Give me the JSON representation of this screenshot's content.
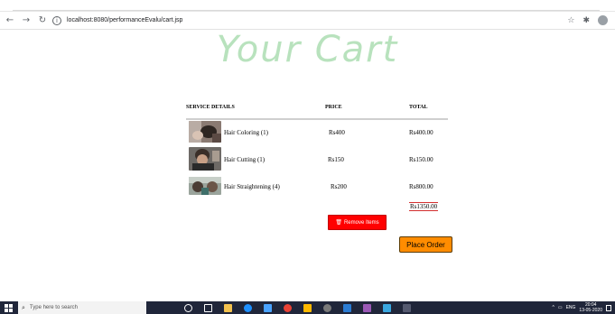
{
  "browser": {
    "url": "localhost:8080/performanceEvalu/cart.jsp",
    "back_icon": "back-arrow-icon",
    "forward_icon": "forward-arrow-icon",
    "reload_icon": "reload-icon",
    "info_icon": "info-icon",
    "star_icon": "star-icon",
    "extensions_icon": "puzzle-icon",
    "profile_icon": "profile-avatar-icon"
  },
  "page": {
    "title": "Your Cart"
  },
  "cart": {
    "headers": {
      "details": "SERVICE DETAILS",
      "price": "PRICE",
      "total": "TOTAL"
    },
    "items": [
      {
        "name": "Hair Coloring (1)",
        "price": "Rs400",
        "total": "Rs400.00"
      },
      {
        "name": "Hair Cutting (1)",
        "price": "Rs150",
        "total": "Rs150.00"
      },
      {
        "name": "Hair Straightening (4)",
        "price": "Rs200",
        "total": "Rs800.00"
      }
    ],
    "grand_total": "Rs1350.00",
    "remove_label": "Remove Items",
    "place_order_label": "Place Order"
  },
  "taskbar": {
    "search_placeholder": "Type here to search",
    "language": "ENG",
    "time": "20:04",
    "date": "13-05-2020"
  },
  "colors": {
    "title": "#b8e2bd",
    "remove_button": "#ff0000",
    "place_order_button": "#ff8c00",
    "taskbar": "#20263a"
  }
}
